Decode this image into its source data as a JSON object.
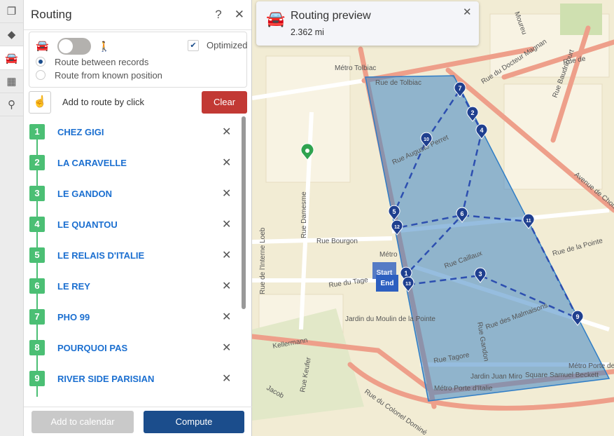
{
  "rail": {
    "tabs": [
      {
        "icon": "layers-copy-icon"
      },
      {
        "icon": "layers-icon"
      },
      {
        "icon": "car-icon",
        "active": true
      },
      {
        "icon": "calendar-icon"
      },
      {
        "icon": "search-icon"
      }
    ]
  },
  "panel": {
    "title": "Routing",
    "help": "?",
    "close": "✕",
    "optimized_label": "Optimized",
    "optimized": true,
    "mode_toggle": "car",
    "radio_between": "Route between records",
    "radio_known": "Route from known position",
    "radio_selected": "between",
    "add_by_click": "Add to route by click",
    "clear": "Clear",
    "stops": [
      {
        "n": "1",
        "name": "CHEZ GIGI"
      },
      {
        "n": "2",
        "name": "LA CARAVELLE"
      },
      {
        "n": "3",
        "name": "LE GANDON"
      },
      {
        "n": "4",
        "name": "LE QUANTOU"
      },
      {
        "n": "5",
        "name": "LE RELAIS D'ITALIE"
      },
      {
        "n": "6",
        "name": "LE REY"
      },
      {
        "n": "7",
        "name": "PHO 99"
      },
      {
        "n": "8",
        "name": "POURQUOI PAS"
      },
      {
        "n": "9",
        "name": "RIVER SIDE PARISIAN"
      }
    ],
    "add_calendar": "Add to calendar",
    "compute": "Compute"
  },
  "toast": {
    "title": "Routing preview",
    "distance": "2.362 mi",
    "close": "✕"
  },
  "map": {
    "colors": {
      "polygon": "#3f86c4",
      "route": "#2d4fb0",
      "marker": "#1f3f8f",
      "road": "#ee9f8a"
    },
    "markers": [
      "7",
      "2",
      "4",
      "10",
      "5",
      "12",
      "6",
      "11",
      "1",
      "13",
      "3",
      "9"
    ],
    "start": "Start",
    "end": "End",
    "labels": [
      "Rue de Tolbiac",
      "Métro Tolbiac",
      "Rue du Docteur Magnan",
      "Moureu",
      "Rue Baudricourt",
      "Rue de",
      "Avenue de Choisy",
      "Rue Auguste Perret",
      "Rue de la Pointe",
      "Rue Damesme",
      "Rue Bourgon",
      "Rue du Tage",
      "Rue de l'Interne Loeb",
      "Jardin du Moulin de la Pointe",
      "Kellermann",
      "Rue Caillaux",
      "Rue des Malmaisons",
      "Rue Gandon",
      "Rue Tagore",
      "Jardin Juan Miro",
      "Square Samuel Beckett",
      "Métro Porte de Choisy",
      "Métro Porte d'Italie",
      "Rue du Colonel Dominé",
      "Rue Keufer",
      "Jacob",
      "Métro"
    ]
  }
}
